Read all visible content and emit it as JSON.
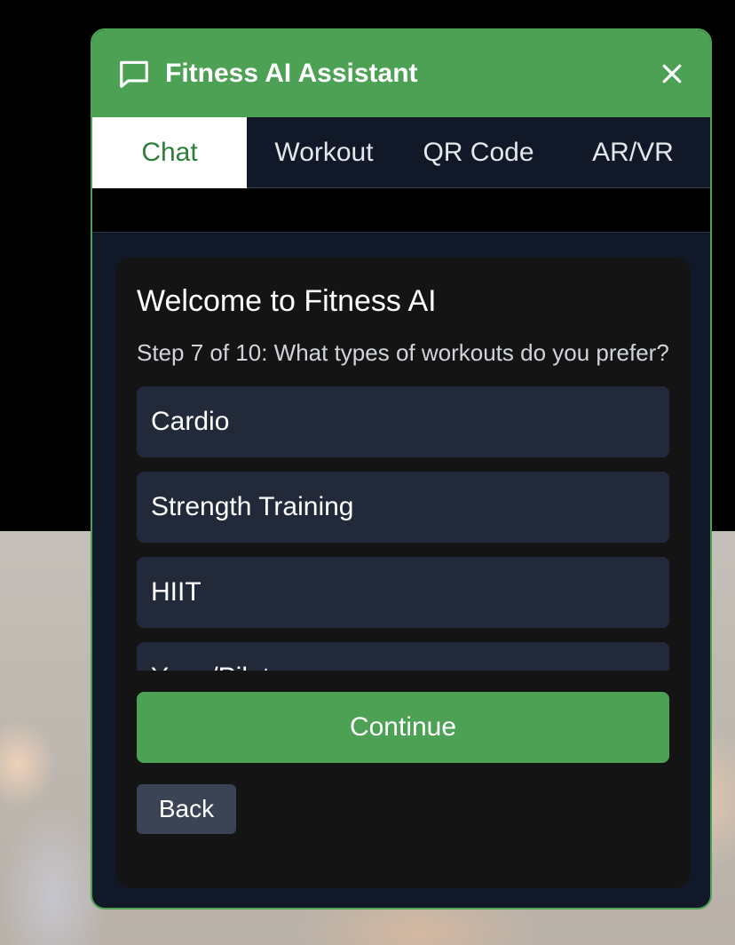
{
  "header": {
    "title": "Fitness AI Assistant",
    "chat_icon": "chat-bubble-icon",
    "close_icon": "close-icon"
  },
  "tabs": [
    {
      "label": "Chat",
      "active": true
    },
    {
      "label": "Workout",
      "active": false
    },
    {
      "label": "QR Code",
      "active": false
    },
    {
      "label": "AR/VR",
      "active": false
    }
  ],
  "card": {
    "title": "Welcome to Fitness AI",
    "step_text": "Step 7 of 10: What types of workouts do you prefer?",
    "options": [
      "Cardio",
      "Strength Training",
      "HIIT",
      "Yoga/Pilates"
    ],
    "continue_label": "Continue",
    "back_label": "Back"
  },
  "colors": {
    "accent": "#4ca154",
    "panel": "#111827",
    "card": "#141414",
    "option": "#222a3a"
  }
}
